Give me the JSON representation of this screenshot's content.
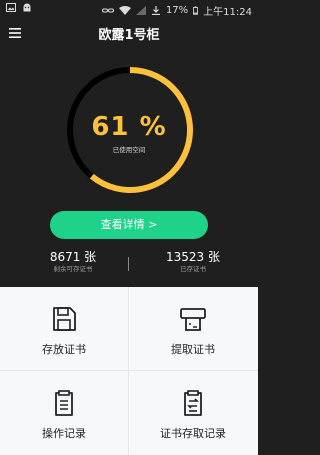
{
  "status_bar": {
    "battery_percent": "17%",
    "time": "上午11:24"
  },
  "header": {
    "title": "欧露1号柜"
  },
  "gauge": {
    "percent_text": "61 %",
    "percent_value": 0.61,
    "label": "已使用空间",
    "track_color": "#000000",
    "fill_color": "#ffc13d"
  },
  "detail_button": {
    "label": "查看详情 >"
  },
  "stats": {
    "remaining": {
      "value": "8671 张",
      "label": "剩余可存证书"
    },
    "stored": {
      "value": "13523 张",
      "label": "已存证书"
    }
  },
  "grid": {
    "items": [
      {
        "label": "存放证书",
        "icon": "save-icon"
      },
      {
        "label": "提取证书",
        "icon": "printer-icon"
      },
      {
        "label": "操作记录",
        "icon": "clipboard-list-icon"
      },
      {
        "label": "证书存取记录",
        "icon": "clipboard-transfer-icon"
      }
    ]
  },
  "colors": {
    "accent_green": "#1ed28a",
    "gauge_yellow": "#ffc13d",
    "background_dark": "#1f1f1f"
  }
}
